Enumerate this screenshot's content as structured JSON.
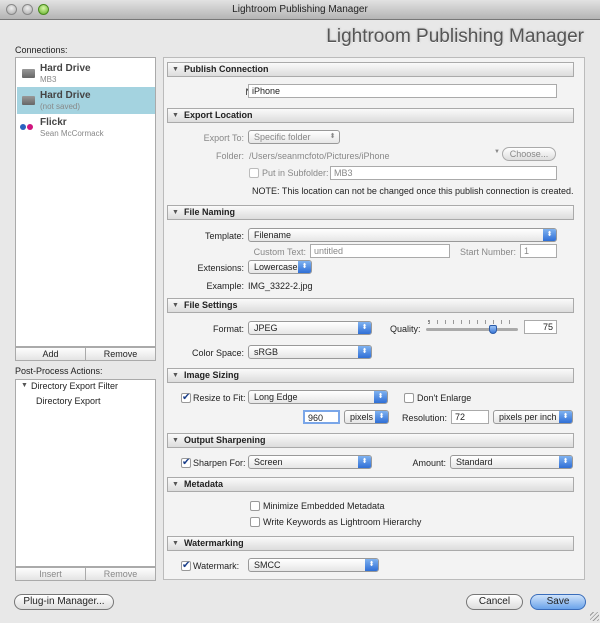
{
  "window": {
    "title": "Lightroom Publishing Manager",
    "header": "Lightroom Publishing Manager"
  },
  "connections": {
    "label": "Connections:",
    "items": [
      {
        "name": "Hard Drive",
        "sub": "MB3",
        "icon": "folder-icon",
        "selected": false
      },
      {
        "name": "Hard Drive",
        "sub": "(not saved)",
        "icon": "folder-icon",
        "selected": true
      },
      {
        "name": "Flickr",
        "sub": "Sean McCormack",
        "icon": "flickr-icon",
        "selected": false
      }
    ],
    "add": "Add",
    "remove": "Remove"
  },
  "post_process": {
    "label": "Post-Process Actions:",
    "group": "Directory Export Filter",
    "item": "Directory Export",
    "insert": "Insert",
    "remove": "Remove"
  },
  "publish_connection": {
    "title": "Publish Connection",
    "name_label": "Name:",
    "name_value": "iPhone"
  },
  "export_location": {
    "title": "Export Location",
    "export_to_label": "Export To:",
    "export_to_value": "Specific folder",
    "folder_label": "Folder:",
    "folder_value": "/Users/seanmcfoto/Pictures/iPhone",
    "choose": "Choose...",
    "subfolder_label": "Put in Subfolder:",
    "subfolder_value": "MB3",
    "subfolder_checked": false,
    "note": "NOTE: This location can not be changed once this publish connection is created."
  },
  "file_naming": {
    "title": "File Naming",
    "template_label": "Template:",
    "template_value": "Filename",
    "custom_text_label": "Custom Text:",
    "custom_text_value": "untitled",
    "start_number_label": "Start Number:",
    "start_number_value": "1",
    "extensions_label": "Extensions:",
    "extensions_value": "Lowercase",
    "example_label": "Example:",
    "example_value": "IMG_3322-2.jpg"
  },
  "file_settings": {
    "title": "File Settings",
    "format_label": "Format:",
    "format_value": "JPEG",
    "quality_label": "Quality:",
    "quality_value": "75",
    "color_space_label": "Color Space:",
    "color_space_value": "sRGB"
  },
  "image_sizing": {
    "title": "Image Sizing",
    "resize_label": "Resize to Fit:",
    "resize_checked": true,
    "resize_value": "Long Edge",
    "dont_enlarge_label": "Don't Enlarge",
    "dont_enlarge_checked": false,
    "size_value": "960",
    "size_unit": "pixels",
    "resolution_label": "Resolution:",
    "resolution_value": "72",
    "resolution_unit": "pixels per inch"
  },
  "output_sharpening": {
    "title": "Output Sharpening",
    "sharpen_label": "Sharpen For:",
    "sharpen_checked": true,
    "sharpen_value": "Screen",
    "amount_label": "Amount:",
    "amount_value": "Standard"
  },
  "metadata": {
    "title": "Metadata",
    "minimize_label": "Minimize Embedded Metadata",
    "minimize_checked": false,
    "keywords_label": "Write Keywords as Lightroom Hierarchy",
    "keywords_checked": false
  },
  "watermarking": {
    "title": "Watermarking",
    "watermark_label": "Watermark:",
    "watermark_checked": true,
    "watermark_value": "SMCC"
  },
  "footer": {
    "plugin_manager": "Plug-in Manager...",
    "cancel": "Cancel",
    "save": "Save"
  },
  "colors": {
    "selection": "#a4d3e0",
    "accent": "#2f6fd6",
    "flickr_blue": "#2b63c0",
    "flickr_pink": "#d0157e"
  }
}
